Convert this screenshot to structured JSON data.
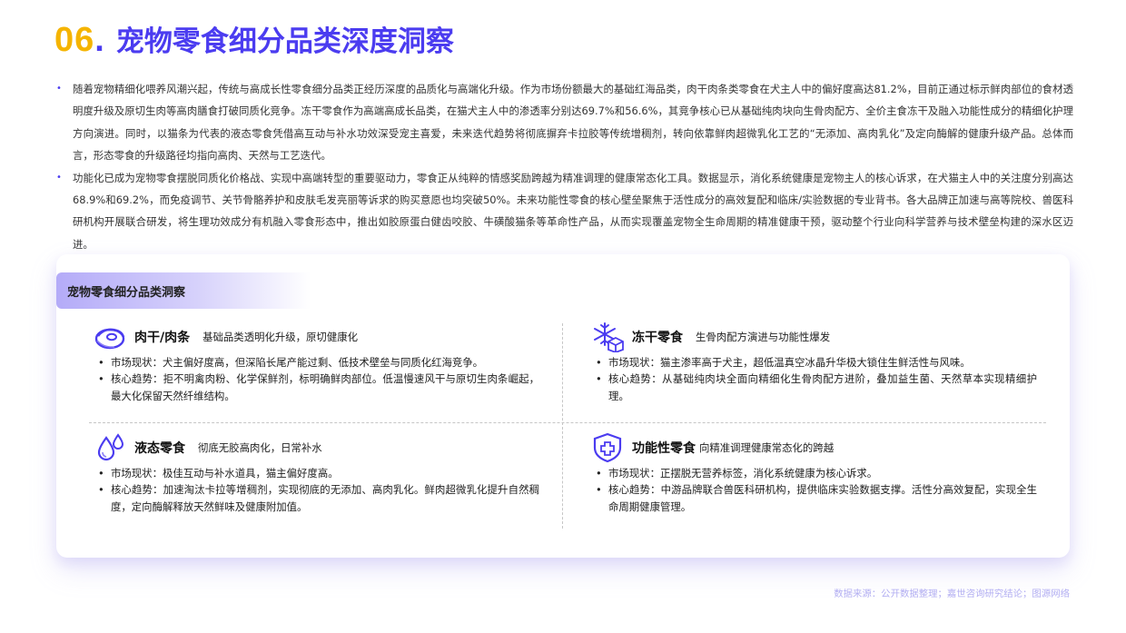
{
  "title": {
    "number": "06",
    "dot": ".",
    "text": "宠物零食细分品类深度洞察"
  },
  "intro": [
    "随着宠物精细化喂养风潮兴起，传统与高成长性零食细分品类正经历深度的品质化与高端化升级。作为市场份额最大的基础红海品类，肉干肉条类零食在犬主人中的偏好度高达81.2%，目前正通过标示鲜肉部位的食材透明度升级及原切生肉等高肉膳食打破同质化竞争。冻干零食作为高端高成长品类，在猫犬主人中的渗透率分别达69.7%和56.6%，其竞争核心已从基础纯肉块向生骨肉配方、全价主食冻干及融入功能性成分的精细化护理方向演进。同时，以猫条为代表的液态零食凭借高互动与补水功效深受宠主喜爱，未来迭代趋势将彻底摒弃卡拉胶等传统增稠剂，转向依靠鲜肉超微乳化工艺的“无添加、高肉乳化”及定向酶解的健康升级产品。总体而言，形态零食的升级路径均指向高肉、天然与工艺迭代。",
    "功能化已成为宠物零食摆脱同质化价格战、实现中高端转型的重要驱动力，零食正从纯粹的情感奖励跨越为精准调理的健康常态化工具。数据显示，消化系统健康是宠物主人的核心诉求，在犬猫主人中的关注度分别高达68.9%和69.2%，而免疫调节、关节骨骼养护和皮肤毛发亮丽等诉求的购买意愿也均突破50%。未来功能性零食的核心壁垒聚焦于活性成分的高效复配和临床/实验数据的专业背书。各大品牌正加速与高等院校、兽医科研机构开展联合研发，将生理功效成分有机融入零食形态中，推出如胶原蛋白健齿咬胶、牛磺酸猫条等革命性产品，从而实现覆盖宠物全生命周期的精准健康干预，驱动整个行业向科学营养与技术壁垒构建的深水区迈进。"
  ],
  "card": {
    "header": "宠物零食细分品类洞察",
    "bullet": "•",
    "cells": [
      {
        "title": "肉干/肉条",
        "subtitle": "基础品类透明化升级，原切健康化",
        "items": [
          "市场现状：犬主偏好度高，但深陷长尾产能过剩、低技术壁垒与同质化红海竞争。",
          "核心趋势：拒不明禽肉粉、化学保鲜剂，标明确鲜肉部位。低温慢速风干与原切生肉条崛起，最大化保留天然纤维结构。"
        ]
      },
      {
        "title": "冻干零食",
        "subtitle": "生骨肉配方演进与功能性爆发",
        "items": [
          "市场现状：猫主渗率高于犬主，超低温真空冰晶升华极大锁住生鲜活性与风味。",
          "核心趋势：从基础纯肉块全面向精细化生骨肉配方进阶，叠加益生菌、天然草本实现精细护理。"
        ]
      },
      {
        "title": "液态零食",
        "subtitle": "彻底无胶高肉化，日常补水",
        "items": [
          "市场现状：极佳互动与补水道具，猫主偏好度高。",
          "核心趋势：加速淘汰卡拉等增稠剂，实现彻底的无添加、高肉乳化。鲜肉超微乳化提升自然稠度，定向酶解释放天然鲜味及健康附加值。"
        ]
      },
      {
        "title": "功能性零食",
        "subtitle": "向精准调理健康常态化的跨越",
        "items": [
          "市场现状：正摆脱无营养标签，消化系统健康为核心诉求。",
          "核心趋势：中游品牌联合兽医科研机构，提供临床实验数据支撑。活性分高效复配，实现全生命周期健康管理。"
        ]
      }
    ]
  },
  "source": "数据来源：公开数据整理；嘉世咨询研究结论；图源网络",
  "icons": [
    "meat-icon",
    "snowflake-cube-icon",
    "droplets-icon",
    "shield-cross-icon"
  ],
  "colors": {
    "accent": "#4b3cf0",
    "number": "#f5b400"
  }
}
